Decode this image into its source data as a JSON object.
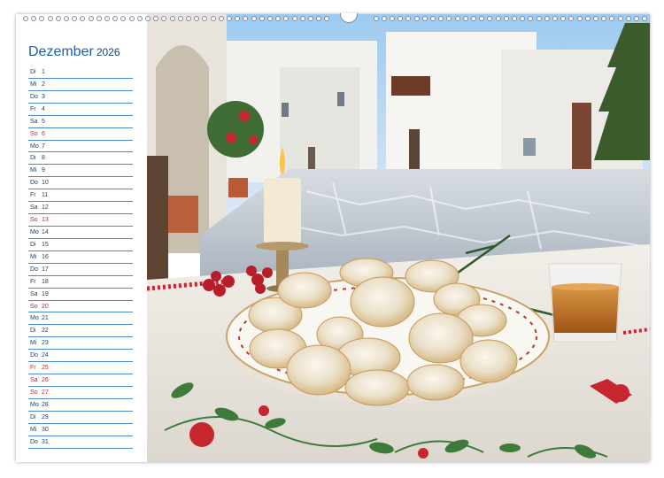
{
  "calendar": {
    "month": "Dezember",
    "year": "2026",
    "days": [
      {
        "weekday": "Di",
        "day": "1",
        "weekend": false
      },
      {
        "weekday": "Mi",
        "day": "2",
        "weekend": false
      },
      {
        "weekday": "Do",
        "day": "3",
        "weekend": false
      },
      {
        "weekday": "Fr",
        "day": "4",
        "weekend": false
      },
      {
        "weekday": "Sa",
        "day": "5",
        "weekend": false
      },
      {
        "weekday": "So",
        "day": "6",
        "weekend": true
      },
      {
        "weekday": "Mo",
        "day": "7",
        "weekend": false
      },
      {
        "weekday": "Di",
        "day": "8",
        "weekend": false
      },
      {
        "weekday": "Mi",
        "day": "9",
        "weekend": false
      },
      {
        "weekday": "Do",
        "day": "10",
        "weekend": false
      },
      {
        "weekday": "Fr",
        "day": "11",
        "weekend": false
      },
      {
        "weekday": "Sa",
        "day": "12",
        "weekend": false
      },
      {
        "weekday": "So",
        "day": "13",
        "weekend": true
      },
      {
        "weekday": "Mo",
        "day": "14",
        "weekend": false
      },
      {
        "weekday": "Di",
        "day": "15",
        "weekend": false
      },
      {
        "weekday": "Mi",
        "day": "16",
        "weekend": false
      },
      {
        "weekday": "Do",
        "day": "17",
        "weekend": false
      },
      {
        "weekday": "Fr",
        "day": "18",
        "weekend": false
      },
      {
        "weekday": "Sa",
        "day": "19",
        "weekend": false
      },
      {
        "weekday": "So",
        "day": "20",
        "weekend": true
      },
      {
        "weekday": "Mo",
        "day": "21",
        "weekend": false
      },
      {
        "weekday": "Di",
        "day": "22",
        "weekend": false
      },
      {
        "weekday": "Mi",
        "day": "23",
        "weekend": false
      },
      {
        "weekday": "Do",
        "day": "24",
        "weekend": false
      },
      {
        "weekday": "Fr",
        "day": "25",
        "weekend": true
      },
      {
        "weekday": "Sa",
        "day": "26",
        "weekend": true
      },
      {
        "weekday": "So",
        "day": "27",
        "weekend": true
      },
      {
        "weekday": "Mo",
        "day": "28",
        "weekend": false
      },
      {
        "weekday": "Di",
        "day": "29",
        "weekend": false
      },
      {
        "weekday": "Mi",
        "day": "30",
        "weekend": false
      },
      {
        "weekday": "Do",
        "day": "31",
        "weekend": false
      }
    ]
  },
  "colors": {
    "title": "#1f5ea8",
    "rule_line": "#4a8ac8",
    "weekday_text": "#1f3f70",
    "holiday_text": "#c0283a"
  }
}
